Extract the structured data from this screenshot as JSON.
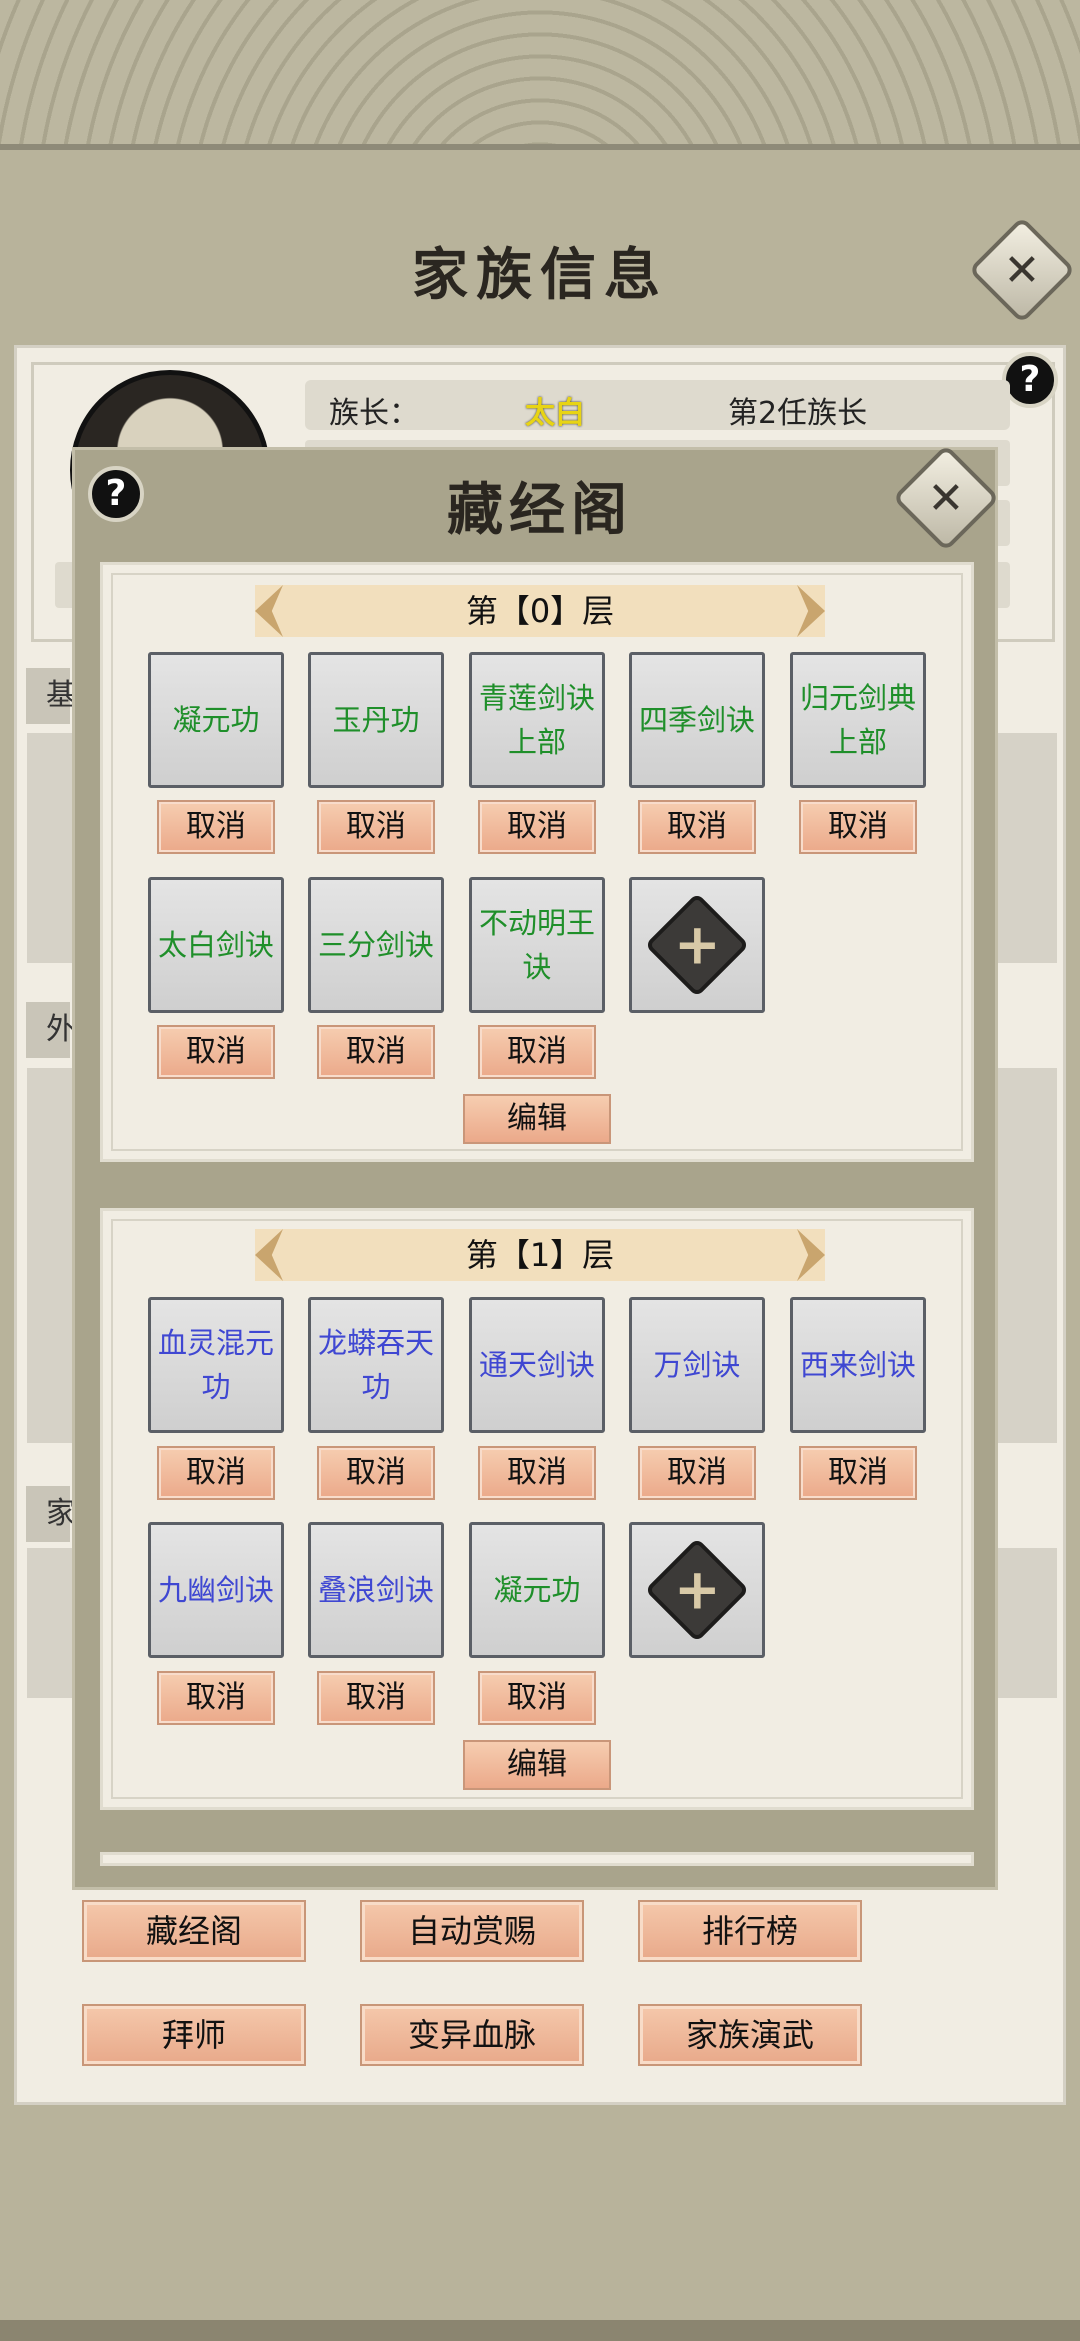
{
  "header": {
    "title": "家族信息"
  },
  "leader": {
    "label": "族长：",
    "name": "太白",
    "generation": "第2任族长"
  },
  "side_tabs": [
    "基",
    "外",
    "家"
  ],
  "library": {
    "title": "藏经阁",
    "cancel_label": "取消",
    "edit_label": "编辑",
    "floors": [
      {
        "title": "第【0】层",
        "items": [
          "凝元功",
          "玉丹功",
          "青莲剑诀上部",
          "四季剑诀",
          "归元剑典上部",
          "太白剑诀",
          "三分剑诀",
          "不动明王诀"
        ]
      },
      {
        "title": "第【1】层",
        "items": [
          "血灵混元功",
          "龙蟒吞天功",
          "通天剑诀",
          "万剑诀",
          "西来剑诀",
          "九幽剑诀",
          "叠浪剑诀",
          "凝元功"
        ]
      }
    ]
  },
  "bottom_buttons": [
    "藏经阁",
    "自动赏赐",
    "排行榜",
    "拜师",
    "变异血脉",
    "家族演武"
  ],
  "icons": {
    "close": "close-icon",
    "help": "help-icon",
    "add": "add-icon"
  }
}
